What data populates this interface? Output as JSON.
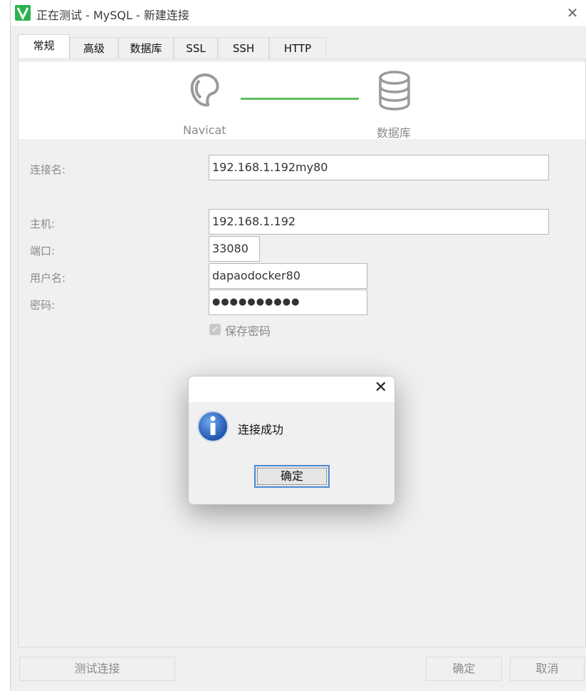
{
  "window": {
    "title": "正在测试 - MySQL - 新建连接",
    "close_glyph": "✕"
  },
  "tabs": [
    {
      "label": "常规",
      "active": true
    },
    {
      "label": "高级"
    },
    {
      "label": "数据库"
    },
    {
      "label": "SSL"
    },
    {
      "label": "SSH"
    },
    {
      "label": "HTTP"
    }
  ],
  "banner": {
    "left_label": "Navicat",
    "right_label": "数据库",
    "left_icon": "navicat-logo-icon",
    "right_icon": "database-icon",
    "connector_color": "#5cbe5c"
  },
  "form": {
    "connection_name": {
      "label": "连接名:",
      "value": "192.168.1.192my80"
    },
    "host": {
      "label": "主机:",
      "value": "192.168.1.192"
    },
    "port": {
      "label": "端口:",
      "value": "33080"
    },
    "username": {
      "label": "用户名:",
      "value": "dapaodocker80"
    },
    "password": {
      "label": "密码:",
      "value": "●●●●●●●●●●"
    },
    "save_password": {
      "label": "保存密码",
      "checked": true
    }
  },
  "buttons": {
    "test": "测试连接",
    "ok": "确定",
    "cancel": "取消"
  },
  "dialog": {
    "message": "连接成功",
    "ok_label": "确定",
    "close_glyph": "✕",
    "icon": "info-icon",
    "accent": "#4a8ad6"
  }
}
